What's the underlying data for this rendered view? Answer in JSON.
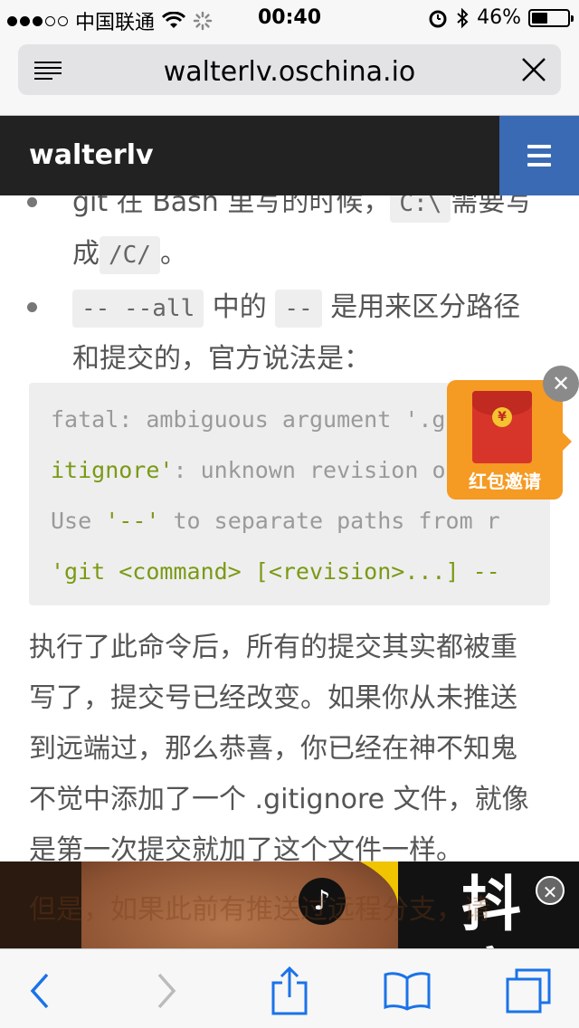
{
  "status_bar": {
    "carrier": "中国联通",
    "time": "00:40",
    "battery_percent": "46%",
    "battery_level": 0.46,
    "signal_bars_filled": 3,
    "signal_bars_total": 5
  },
  "address_bar": {
    "url": "walterlv.oschina.io"
  },
  "site": {
    "title": "walterlv"
  },
  "article": {
    "bullet1": {
      "text_a": "git 在 Bash 里写的时候，",
      "code_a": "C:\\",
      "text_b": "需要写",
      "text_c": "成",
      "code_b": "/C/",
      "text_d": "。"
    },
    "bullet2": {
      "code_a": "-- --all",
      "text_a": "中的",
      "code_b": "--",
      "text_b": "是用来区分路径",
      "text_c": "和提交的，官方说法是："
    },
    "code_block": {
      "line1": "fatal: ambiguous argument '.gi",
      "line2_green": "itignore'",
      "line2_rest": ": unknown revision or",
      "line3_a": "Use ",
      "line3_green": "'--'",
      "line3_b": " to separate paths from r",
      "line4_green": "'git <command> [<revision>...] --"
    },
    "para_lines": [
      "执行了此命令后，所有的提交其实都被重",
      "写了，提交号已经改变。如果你从未推送",
      "到远端过，那么恭喜，你已经在神不知鬼",
      "不觉中添加了一个 .gitignore 文件，就像",
      "是第一次提交就加了这个文件一样。"
    ],
    "next_line_partial": "但是，如果此前有推送过远程分支，请"
  },
  "popup": {
    "label": "红包邀请",
    "coin": "¥",
    "close": "✕"
  },
  "ad": {
    "brand": "抖音",
    "close": "✕"
  },
  "colors": {
    "header_bg": "#222222",
    "menu_button": "#3a6ab4",
    "code_green": "#7a9a14",
    "popup_orange": "#f59a23",
    "ad_yellow": "#f1c400"
  }
}
